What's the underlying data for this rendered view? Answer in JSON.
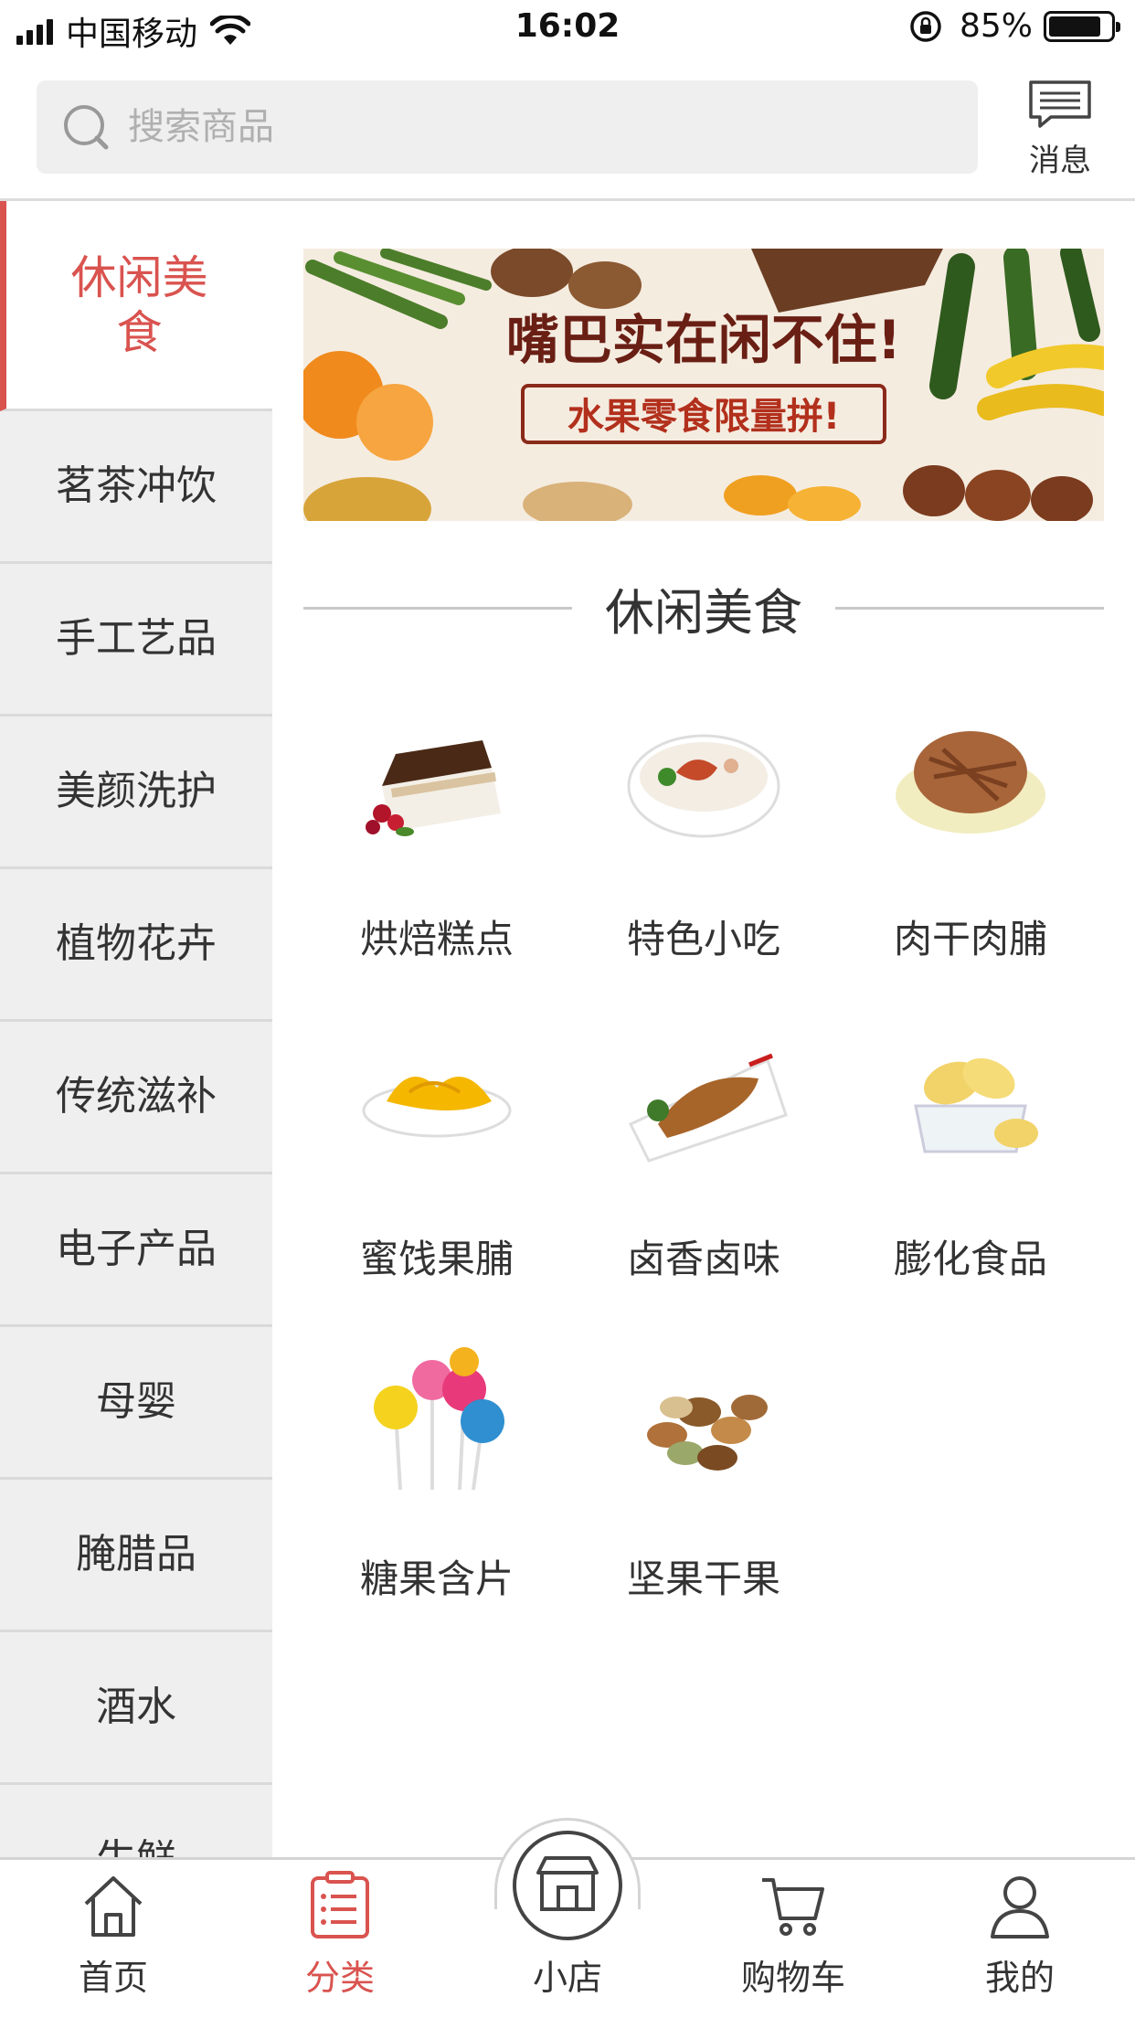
{
  "status_bar": {
    "carrier": "中国移动",
    "time": "16:02",
    "battery_percent": "85%",
    "battery_level": 0.85
  },
  "search": {
    "placeholder": "搜索商品",
    "icon": "search-icon"
  },
  "message": {
    "label": "消息",
    "icon": "message-icon"
  },
  "sidebar": {
    "items": [
      {
        "label": "休闲美食",
        "active": true
      },
      {
        "label": "茗茶冲饮"
      },
      {
        "label": "手工艺品"
      },
      {
        "label": "美颜洗护"
      },
      {
        "label": "植物花卉"
      },
      {
        "label": "传统滋补"
      },
      {
        "label": "电子产品"
      },
      {
        "label": "母婴"
      },
      {
        "label": "腌腊品"
      },
      {
        "label": "酒水"
      },
      {
        "label": "生鲜"
      }
    ]
  },
  "banner": {
    "headline": "嘴巴实在闲不住!",
    "subline": "水果零食限量拼!"
  },
  "section": {
    "title": "休闲美食"
  },
  "categories": [
    {
      "label": "烘焙糕点",
      "icon": "cake-icon"
    },
    {
      "label": "特色小吃",
      "icon": "snack-bowl-icon"
    },
    {
      "label": "肉干肉脯",
      "icon": "jerky-icon"
    },
    {
      "label": "蜜饯果脯",
      "icon": "dried-fruit-icon"
    },
    {
      "label": "卤香卤味",
      "icon": "braised-duck-icon"
    },
    {
      "label": "膨化食品",
      "icon": "chips-icon"
    },
    {
      "label": "糖果含片",
      "icon": "lollipop-icon"
    },
    {
      "label": "坚果干果",
      "icon": "nuts-icon"
    }
  ],
  "tabbar": {
    "tabs": [
      {
        "label": "首页",
        "icon": "home-icon"
      },
      {
        "label": "分类",
        "icon": "category-icon",
        "active": true
      },
      {
        "label": "小店",
        "icon": "store-icon"
      },
      {
        "label": "购物车",
        "icon": "cart-icon"
      },
      {
        "label": "我的",
        "icon": "profile-icon"
      }
    ]
  },
  "colors": {
    "accent": "#d9534f",
    "sidebar_bg": "#efefef",
    "divider": "#dadada"
  }
}
